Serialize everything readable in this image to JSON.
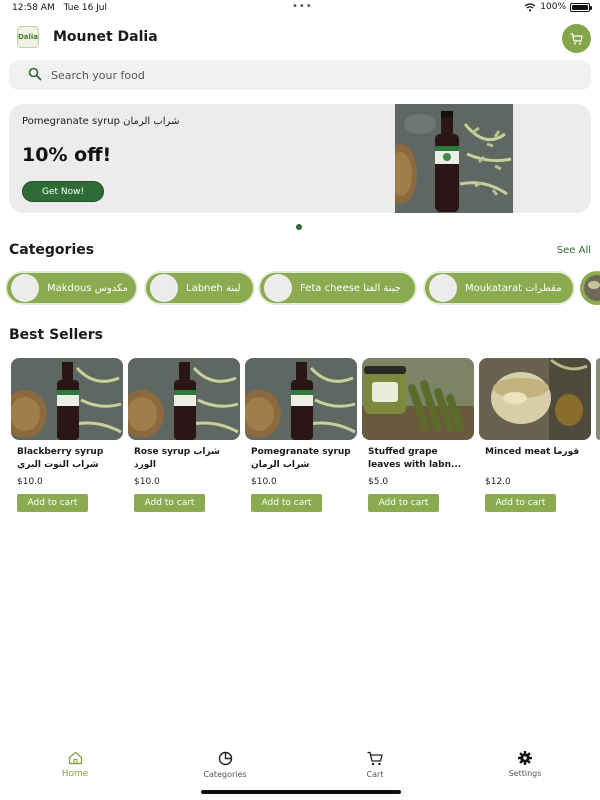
{
  "status_bar": {
    "time": "12:58 AM",
    "date": "Tue 16 Jul",
    "battery": "100%"
  },
  "header": {
    "logo_text": "Dalia",
    "title": "Mounet Dalia"
  },
  "search": {
    "placeholder": "Search your food"
  },
  "banner": {
    "subtitle": "Pomegranate syrup شراب الرمان",
    "discount": "10% off!",
    "cta_label": "Get Now!"
  },
  "categories": {
    "title": "Categories",
    "see_all": "See All",
    "items": [
      {
        "label": "Makdous مكدوس"
      },
      {
        "label": "Labneh لبنة"
      },
      {
        "label": "Feta cheese جبنة الفتا"
      },
      {
        "label": "Moukatarat مقطرات"
      }
    ]
  },
  "best_sellers": {
    "title": "Best Sellers",
    "add_label": "Add to cart",
    "items": [
      {
        "name": "Blackberry syrup شراب التوت البري",
        "price": "$10.0"
      },
      {
        "name": "Rose syrup شراب الورد",
        "price": "$10.0"
      },
      {
        "name": "Pomegranate syrup شراب الرمان",
        "price": "$10.0"
      },
      {
        "name": "Stuffed grape leaves with labn...",
        "price": "$5.0"
      },
      {
        "name": "Minced meat قورما",
        "price": "$12.0"
      }
    ]
  },
  "bottom_nav": {
    "items": [
      {
        "label": "Home",
        "icon": "home-icon",
        "active": true
      },
      {
        "label": "Categories",
        "icon": "pie-chart-icon"
      },
      {
        "label": "Cart",
        "icon": "cart-icon"
      },
      {
        "label": "Settings",
        "icon": "gear-icon"
      }
    ]
  },
  "colors": {
    "accent": "#83a64a",
    "dark_green": "#2e6b35",
    "chip": "#8bab50"
  }
}
